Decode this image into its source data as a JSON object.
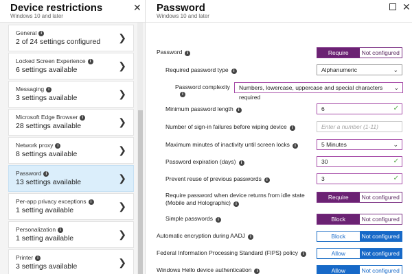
{
  "left": {
    "title": "Device restrictions",
    "subtitle": "Windows 10 and later",
    "close_glyph": "✕",
    "items": [
      {
        "label": "General",
        "status": "2 of 24 settings configured",
        "active": false
      },
      {
        "label": "Locked Screen Experience",
        "status": "6 settings available",
        "active": false
      },
      {
        "label": "Messaging",
        "status": "3 settings available",
        "active": false
      },
      {
        "label": "Microsoft Edge Browser",
        "status": "28 settings available",
        "active": false
      },
      {
        "label": "Network proxy",
        "status": "8 settings available",
        "active": false
      },
      {
        "label": "Password",
        "status": "13 settings available",
        "active": true
      },
      {
        "label": "Per-app privacy exceptions",
        "status": "1 setting available",
        "active": false
      },
      {
        "label": "Personalization",
        "status": "1 setting available",
        "active": false
      },
      {
        "label": "Printer",
        "status": "3 settings available",
        "active": false
      }
    ]
  },
  "right": {
    "title": "Password",
    "subtitle": "Windows 10 and later",
    "close_glyph": "✕",
    "settings": {
      "password": {
        "label": "Password",
        "on": "Require",
        "off": "Not configured"
      },
      "password_type": {
        "label": "Required password type",
        "value": "Alphanumeric"
      },
      "complexity": {
        "label": "Password complexity",
        "value": "Numbers, lowercase, uppercase and special characters required"
      },
      "min_length": {
        "label": "Minimum password length",
        "value": "6"
      },
      "signin_failures": {
        "label": "Number of sign-in failures before wiping device",
        "placeholder": "Enter a number (1-11)"
      },
      "inactivity": {
        "label": "Maximum minutes of inactivity until screen locks",
        "value": "5 Minutes"
      },
      "expiration": {
        "label": "Password expiration (days)",
        "value": "30"
      },
      "reuse": {
        "label": "Prevent reuse of previous passwords",
        "value": "3"
      },
      "idle_return": {
        "label_line1": "Require password when device returns from idle state",
        "label_line2": "(Mobile and Holographic)",
        "on": "Require",
        "off": "Not configured"
      },
      "simple": {
        "label": "Simple passwords",
        "on": "Block",
        "off": "Not configured"
      },
      "encryption": {
        "label": "Automatic encryption during AADJ",
        "on": "Block",
        "off": "Not configured"
      },
      "fips": {
        "label": "Federal Information Processing Standard (FIPS) policy",
        "on": "Allow",
        "off": "Not configured"
      },
      "hello": {
        "label": "Windows Hello device authentication",
        "on": "Allow",
        "off": "Not configured"
      }
    }
  },
  "icons": {
    "info": "i",
    "chevron_right": "❯",
    "chevron_down": "⌄",
    "check": "✓"
  },
  "colors": {
    "accent_purple": "#6b2273",
    "accent_blue": "#1769c8",
    "selected_item": "#dbeefb",
    "valid_check": "#57a64a"
  }
}
